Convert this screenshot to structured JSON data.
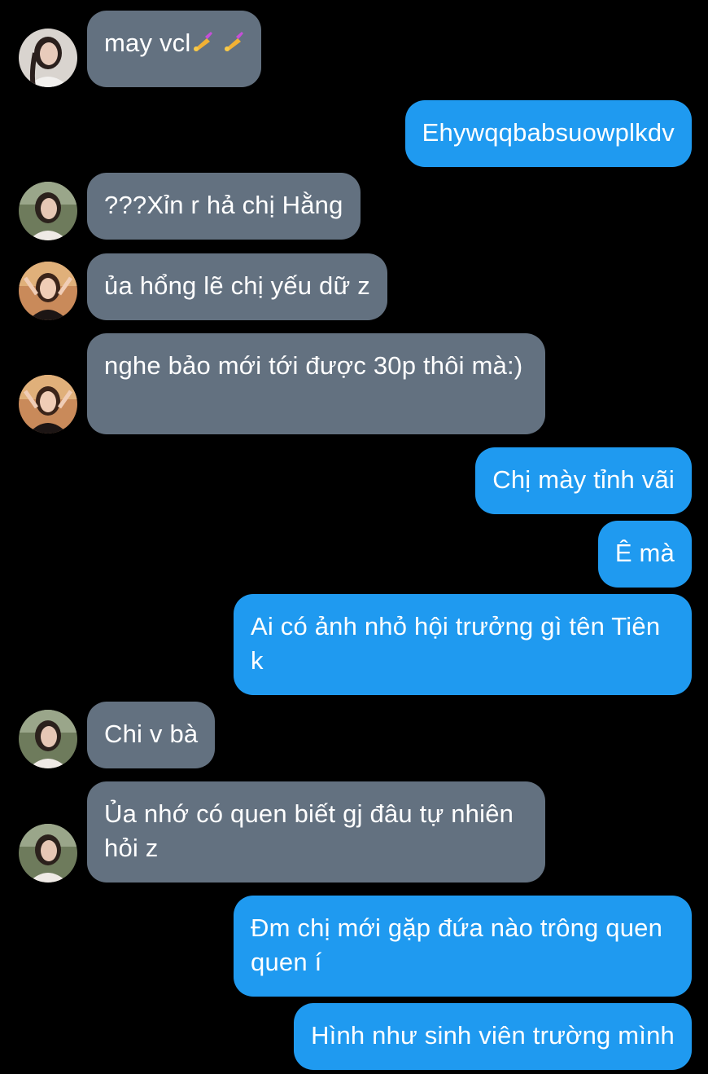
{
  "messages": [
    {
      "from": "other",
      "text": "may vcl",
      "emoji_suffix": "nail-polish-emoji nail-polish-emoji",
      "avatar": "avatar-girl-white-top"
    },
    {
      "from": "me",
      "text": "Ehywqqbabsuowplkdv"
    },
    {
      "from": "other",
      "text": "???Xỉn r hả chị Hằng",
      "avatar": "avatar-girl-outdoor"
    },
    {
      "from": "other",
      "text": "ủa hổng lẽ chị yếu dữ z",
      "avatar": "avatar-girl-sunset"
    },
    {
      "from": "other",
      "text": "nghe bảo mới tới được 30p thôi mà:)",
      "avatar": "avatar-girl-sunset"
    },
    {
      "from": "me",
      "text": "Chị mày tỉnh vãi"
    },
    {
      "from": "me",
      "text": "Ê mà"
    },
    {
      "from": "me",
      "text": "Ai có ảnh nhỏ hội trưởng gì tên Tiên k"
    },
    {
      "from": "other",
      "text": "Chi v bà",
      "avatar": "avatar-girl-outdoor"
    },
    {
      "from": "other",
      "text": "Ủa nhớ có quen biết gj đâu tự nhiên hỏi z",
      "avatar": "avatar-girl-outdoor"
    },
    {
      "from": "me",
      "text": "Đm chị mới gặp đứa nào trông quen quen í"
    },
    {
      "from": "me",
      "text": "Hình như sinh viên trường mình"
    }
  ],
  "colors": {
    "background": "#000000",
    "incoming_bubble": "#637180",
    "outgoing_bubble": "#1f9af0",
    "text": "#ffffff"
  }
}
